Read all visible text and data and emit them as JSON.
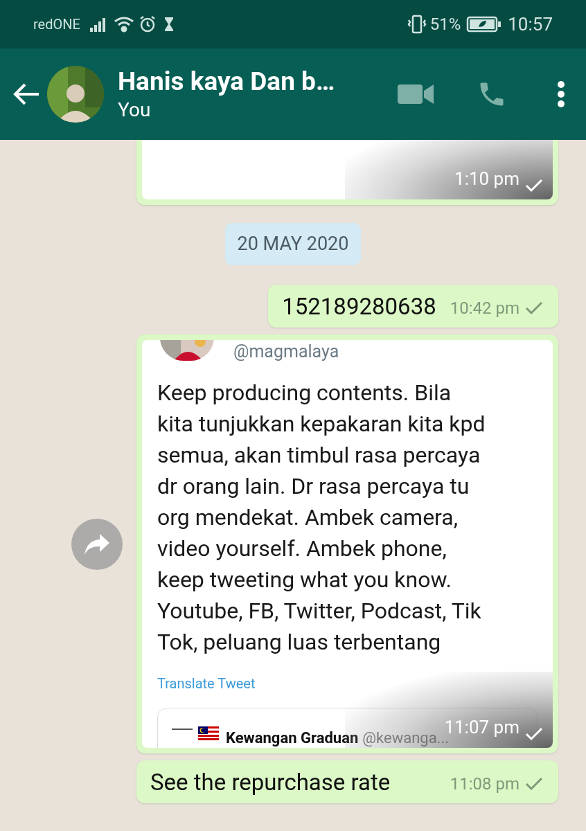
{
  "status_bar": {
    "carrier": "redONE",
    "battery": "51%",
    "time": "10:57"
  },
  "header": {
    "title": "Hanis kaya Dan b…",
    "subtitle": "You"
  },
  "messages": [
    {
      "time": "1:10 pm",
      "delivered": true,
      "content": {
        "kind": "blank"
      }
    },
    {
      "kind": "date",
      "text": "20 MAY 2020"
    },
    {
      "kind": "text",
      "text": "152189280638",
      "time": "10:42 pm",
      "delivered": true
    },
    {
      "time": "11:07 pm",
      "delivered": true,
      "forward": true,
      "content": {
        "kind": "tweet",
        "handle": "@magmalaya",
        "lines": [
          "Keep producing contents. Bila",
          "kita tunjukkan kepakaran kita kpd",
          "semua, akan timbul rasa percaya",
          "dr orang lain. Dr rasa percaya tu",
          "org mendekat. Ambek camera,",
          "video yourself. Ambek phone,",
          "keep tweeting what you know.",
          "Youtube, FB, Twitter, Podcast, Tik",
          "Tok, peluang luas terbentang"
        ],
        "translate": "Translate Tweet",
        "quote": {
          "name": "Kewangan Graduan",
          "handle": "@kewanga..."
        }
      }
    },
    {
      "kind": "text",
      "text": "See the repurchase rate",
      "time": "11:08 pm",
      "delivered": true
    }
  ]
}
